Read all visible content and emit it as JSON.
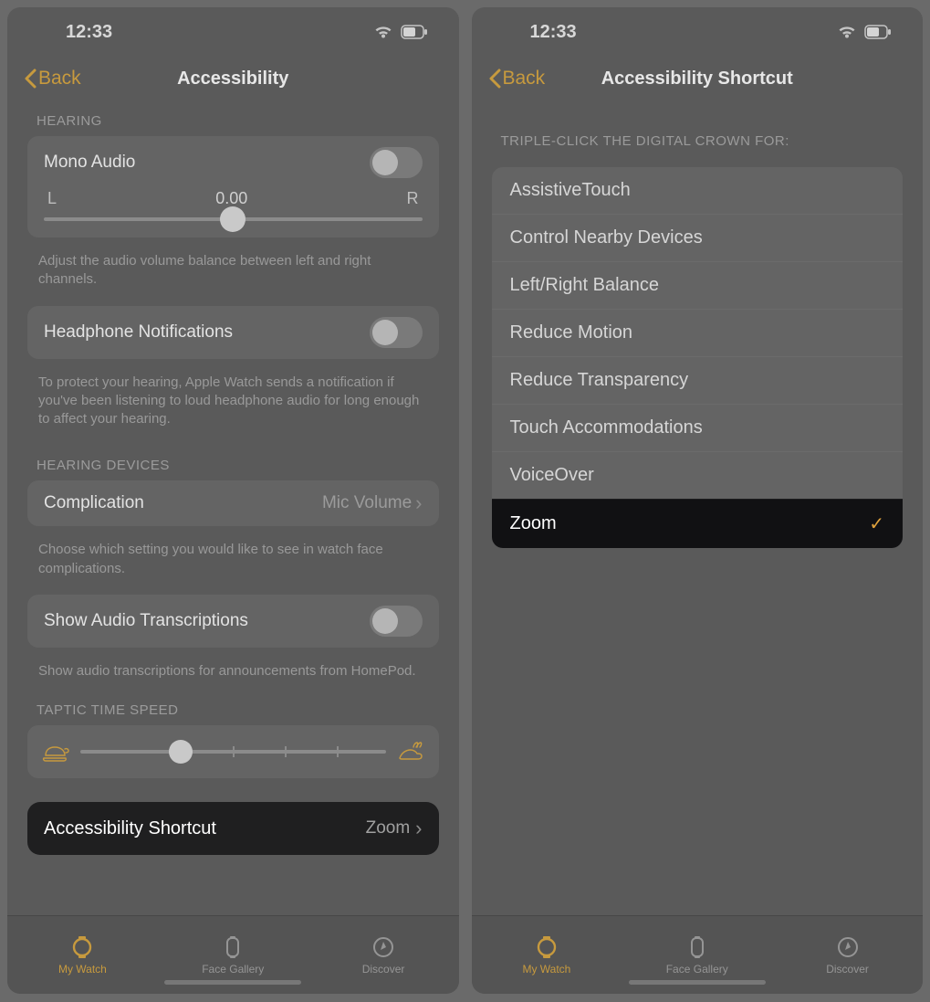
{
  "status": {
    "time": "12:33"
  },
  "phone1": {
    "back": "Back",
    "title": "Accessibility",
    "hearing_header": "HEARING",
    "mono_audio": "Mono Audio",
    "balance": {
      "left": "L",
      "value": "0.00",
      "right": "R"
    },
    "balance_caption": "Adjust the audio volume balance between left and right channels.",
    "headphone_notifications": "Headphone Notifications",
    "headphone_caption": "To protect your hearing, Apple Watch sends a notification if you've been listening to loud headphone audio for long enough to affect your hearing.",
    "hearing_devices_header": "HEARING DEVICES",
    "complication": "Complication",
    "complication_value": "Mic Volume",
    "complication_caption": "Choose which setting you would like to see in watch face complications.",
    "show_audio_transcriptions": "Show Audio Transcriptions",
    "transcriptions_caption": "Show audio transcriptions for announcements from HomePod.",
    "taptic_header": "TAPTIC TIME SPEED",
    "shortcut_label": "Accessibility Shortcut",
    "shortcut_value": "Zoom",
    "tabs": {
      "my_watch": "My Watch",
      "face_gallery": "Face Gallery",
      "discover": "Discover"
    }
  },
  "phone2": {
    "back": "Back",
    "title": "Accessibility Shortcut",
    "list_header": "TRIPLE-CLICK THE DIGITAL CROWN FOR:",
    "items": [
      "AssistiveTouch",
      "Control Nearby Devices",
      "Left/Right Balance",
      "Reduce Motion",
      "Reduce Transparency",
      "Touch Accommodations",
      "VoiceOver",
      "Zoom"
    ],
    "selected_index": 7,
    "tabs": {
      "my_watch": "My Watch",
      "face_gallery": "Face Gallery",
      "discover": "Discover"
    }
  }
}
